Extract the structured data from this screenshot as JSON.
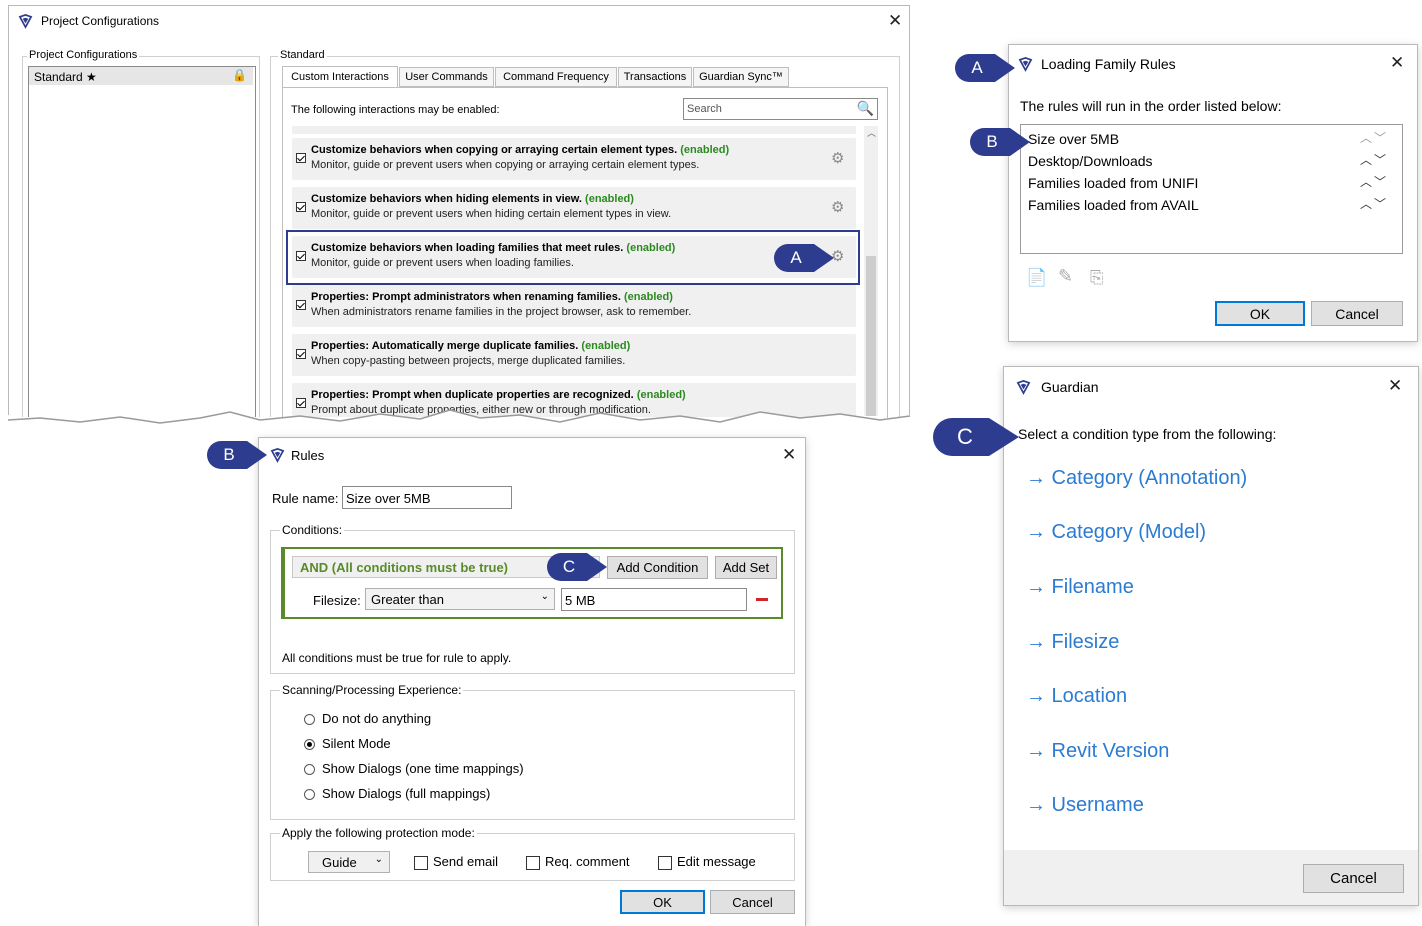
{
  "project_config": {
    "title": "Project Configurations",
    "left_group_label": "Project Configurations",
    "config_item": "Standard ★",
    "right_group_label": "Standard",
    "tabs": [
      "Custom Interactions",
      "User Commands",
      "Command Frequency",
      "Transactions",
      "Guardian Sync™"
    ],
    "intro": "The following interactions may be enabled:",
    "search_placeholder": "Search",
    "enabled_tag": "(enabled)",
    "rows": [
      {
        "title": "Customize behaviors when copying or arraying certain element types.",
        "desc": "Monitor, guide or prevent users when copying or arraying certain element types."
      },
      {
        "title": "Customize behaviors when hiding elements in view.",
        "desc": "Monitor, guide or prevent users when hiding certain element types in view."
      },
      {
        "title": "Customize behaviors when loading families that meet rules.",
        "desc": "Monitor, guide or prevent users when loading families."
      },
      {
        "title": "Properties: Prompt administrators when renaming families.",
        "desc": "When administrators rename families in the project browser, ask to remember."
      },
      {
        "title": "Properties: Automatically merge duplicate families.",
        "desc": "When copy-pasting between projects, merge duplicated families."
      },
      {
        "title": "Properties: Prompt when duplicate properties are recognized.",
        "desc": "Prompt about duplicate properties, either new or through modification."
      }
    ]
  },
  "callouts": {
    "a": "A",
    "b": "B",
    "c": "C"
  },
  "loading_rules": {
    "title": "Loading Family Rules",
    "intro": "The rules will run in the order listed below:",
    "items": [
      "Size over 5MB",
      "Desktop/Downloads",
      "Families loaded from UNIFI",
      "Families loaded from AVAIL"
    ],
    "ok": "OK",
    "cancel": "Cancel"
  },
  "rules": {
    "title": "Rules",
    "rule_name_label": "Rule name:",
    "rule_name_value": "Size over 5MB",
    "conditions_label": "Conditions:",
    "and_label": "AND (All conditions must be true)",
    "add_condition": "Add Condition",
    "add_set": "Add Set",
    "filesize_label": "Filesize:",
    "operator": "Greater than",
    "value": "5 MB",
    "all_true_note": "All conditions must be true for rule to apply.",
    "scanning_label": "Scanning/Processing Experience:",
    "options": [
      "Do not do anything",
      "Silent Mode",
      "Show Dialogs (one time mappings)",
      "Show Dialogs (full mappings)"
    ],
    "selected_option": "Silent Mode",
    "protection_label": "Apply the following protection mode:",
    "mode": "Guide",
    "send_email": "Send email",
    "req_comment": "Req. comment",
    "edit_message": "Edit message",
    "ok": "OK",
    "cancel": "Cancel"
  },
  "guardian": {
    "title": "Guardian",
    "intro": "Select a condition type from the following:",
    "links": [
      "→ Category (Annotation)",
      "→ Category (Model)",
      "→ Filename",
      "→ Filesize",
      "→ Location",
      "→ Revit Version",
      "→ Username"
    ],
    "cancel": "Cancel"
  },
  "colors": {
    "accent": "#0078d7",
    "enabled": "#2b8a1f",
    "callout": "#2e3c8f",
    "link": "#2b7bd1",
    "and_group": "#5a8a2a"
  }
}
